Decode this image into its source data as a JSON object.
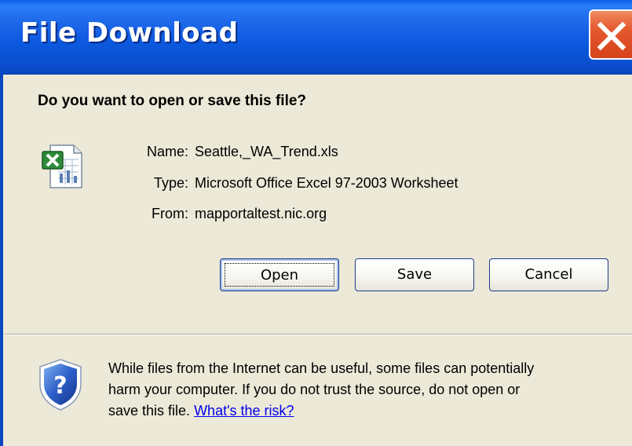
{
  "window": {
    "title": "File Download",
    "close_icon": "close-x-icon"
  },
  "prompt": {
    "question": "Do you want to open or save this file?"
  },
  "file": {
    "icon": "excel-file-icon",
    "name_label": "Name:",
    "name_value": "Seattle,_WA_Trend.xls",
    "type_label": "Type:",
    "type_value": "Microsoft Office Excel 97-2003 Worksheet",
    "from_label": "From:",
    "from_value": "mapportaltest.nic.org"
  },
  "buttons": {
    "open_label": "Open",
    "save_label": "Save",
    "cancel_label": "Cancel"
  },
  "warning": {
    "icon": "security-shield-question-icon",
    "line1": "While files from the Internet can be useful, some files can potentially",
    "line2": "harm your computer. If you do not trust the source, do not open or",
    "line3_prefix": "save this file.",
    "risk_link": "What's the risk?"
  },
  "colors": {
    "titlebar": "#0a50d0",
    "dialog_bg": "#ece9d8",
    "close_button": "#d7421a",
    "link": "#0000ee"
  }
}
